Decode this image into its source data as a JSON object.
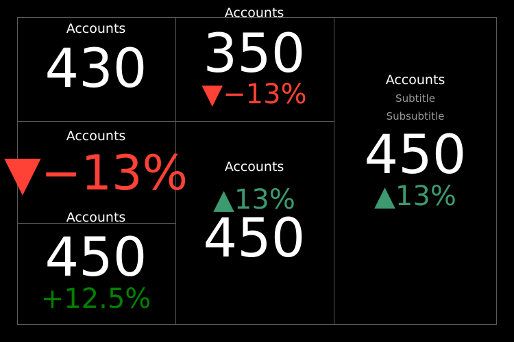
{
  "colors": {
    "background": "#000000",
    "text": "#ffffff",
    "subtitle": "#999999",
    "decreasing": "#ff4136",
    "increasing": "#3d9970",
    "relative_positive": "#008000",
    "grid": "#5a5a5a"
  },
  "chart_data": [
    {
      "type": "indicator",
      "mode": "number",
      "title": "Accounts",
      "value": 430,
      "value_text": "430"
    },
    {
      "type": "indicator",
      "mode": "number+delta",
      "title": "Accounts",
      "value": 350,
      "value_text": "350",
      "delta": -13,
      "delta_text": "▼−13%"
    },
    {
      "type": "indicator",
      "mode": "number+delta",
      "title": "Accounts",
      "subtitle": "Subtitle",
      "subsubtitle": "Subsubtitle",
      "value": 450,
      "value_text": "450",
      "delta": 13,
      "delta_text": "▲13%"
    },
    {
      "type": "indicator",
      "mode": "delta",
      "title": "Accounts",
      "delta": -13,
      "delta_text": "▼−13%"
    },
    {
      "type": "indicator",
      "mode": "number+delta",
      "delta_position": "top",
      "title": "Accounts",
      "value": 450,
      "value_text": "450",
      "delta": 13,
      "delta_text": "▲13%"
    },
    {
      "type": "indicator",
      "mode": "number+delta",
      "title": "Accounts",
      "value": 450,
      "value_text": "450",
      "delta": 12.5,
      "delta_text": "+12.5%"
    }
  ]
}
